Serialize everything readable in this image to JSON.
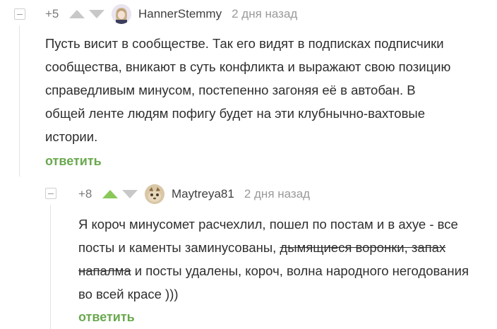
{
  "comments": [
    {
      "rating": "+5",
      "username": "HannerStemmy",
      "time": "2 дня назад",
      "text": "Пусть висит в сообществе. Так его видят в подписках подписчики сообщества, вникают в суть конфликта и выражают свою позицию справедливым минусом, постепенно загоняя её в автобан. В общей ленте людям пофигу будет на эти клубнычно-вахтовые истории.",
      "reply_label": "ответить",
      "upvoted": false
    },
    {
      "rating": "+8",
      "username": "Maytreya81",
      "time": "2 дня назад",
      "text_before": "Я короч минусомет расчехлил, пошел по постам и в ахуе - все посты и каменты заминусованы,",
      "text_struck": "дымящиеся воронки, запах напалма",
      "text_after": "и посты удалены, короч, волна народного негодования во всей красе )))",
      "reply_label": "ответить",
      "upvoted": true
    }
  ],
  "colors": {
    "accent_green": "#6aa84f",
    "upvote_active": "#8ac858",
    "vote_inactive": "#c8c8c8",
    "meta_gray": "#9a9a9a",
    "text": "#2e2e2e"
  },
  "icons": [
    "collapse-icon",
    "upvote-arrow-icon",
    "downvote-arrow-icon",
    "avatar"
  ]
}
